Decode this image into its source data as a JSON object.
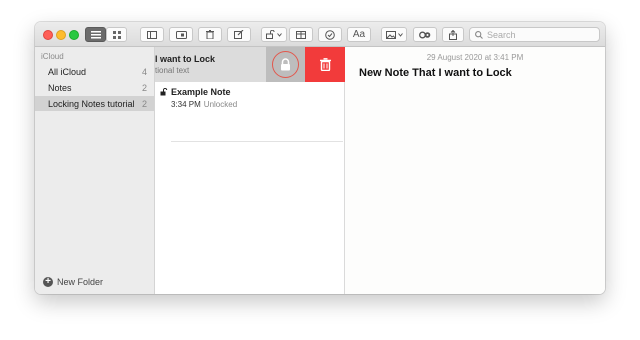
{
  "toolbar": {
    "search_placeholder": "Search",
    "format_label": "Aa"
  },
  "sidebar": {
    "section": "iCloud",
    "folders": [
      {
        "label": "All iCloud",
        "count": "4"
      },
      {
        "label": "Notes",
        "count": "2"
      },
      {
        "label": "Locking Notes tutorial",
        "count": "2"
      }
    ],
    "new_folder_label": "New Folder"
  },
  "notes": [
    {
      "title": "l want to Lock",
      "subtitle": "tional text"
    },
    {
      "title": "Example Note",
      "time": "3:34 PM",
      "status": "Unlocked"
    }
  ],
  "editor": {
    "date": "29 August 2020 at 3:41 PM",
    "title": "New Note That I want to Lock"
  },
  "colors": {
    "delete_red": "#f23b3b",
    "lock_ring": "#e2574c",
    "selected_folder": "#d2d2d2"
  }
}
